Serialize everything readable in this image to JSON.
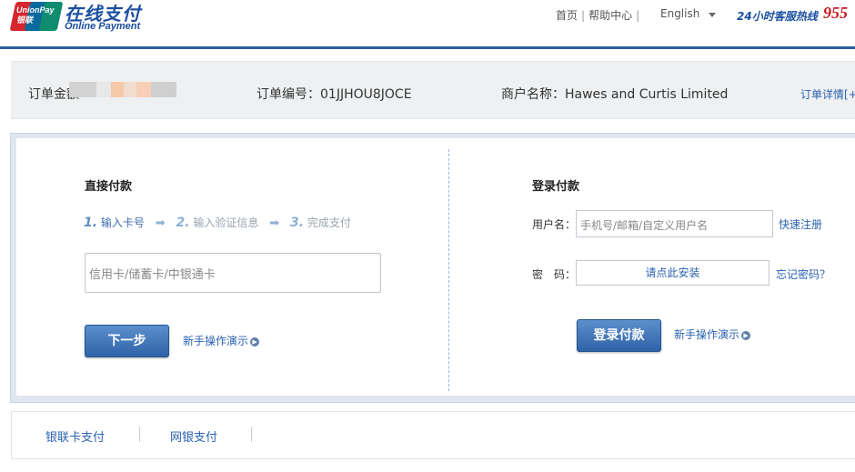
{
  "header": {
    "logo_en": "UnionPay",
    "logo_cn": "银联",
    "brand_cn": "在线支付",
    "brand_en": "Online Payment",
    "nav": [
      "首页",
      "帮助中心"
    ],
    "separator": "|",
    "language": "English",
    "hotline_label": "24小时客服热线",
    "hotline_number": "955"
  },
  "order": {
    "amount_label": "订单金额",
    "number_label": "订单编号：",
    "number_value": "01JJHOU8JOCE",
    "merchant_label": "商户名称：",
    "merchant_value": "Hawes and Curtis Limited",
    "detail_link": "订单详情[+]"
  },
  "direct_pay": {
    "title": "直接付款",
    "steps": [
      {
        "num": "1.",
        "label": "输入卡号",
        "active": true
      },
      {
        "num": "2.",
        "label": "输入验证信息",
        "active": false
      },
      {
        "num": "3.",
        "label": "完成支付",
        "active": false
      }
    ],
    "card_placeholder": "信用卡/储蓄卡/中银通卡",
    "next_button": "下一步",
    "demo_link": "新手操作演示"
  },
  "login_pay": {
    "title": "登录付款",
    "username_label": "用户名：",
    "username_placeholder": "手机号/邮箱/自定义用户名",
    "register_link": "快速注册",
    "password_label": "密　码：",
    "password_prompt": "请点此安装",
    "forgot_link": "忘记密码？",
    "login_button": "登录付款",
    "demo_link": "新手操作演示"
  },
  "bottom_tabs": [
    "银联卡支付",
    "网银支付"
  ],
  "colors": {
    "brand_blue": "#1a4fa0",
    "link_blue": "#2a62b0",
    "button_blue": "#2f63a8",
    "hotline_red": "#c8161d",
    "header_rule": "#2b5d9c"
  }
}
